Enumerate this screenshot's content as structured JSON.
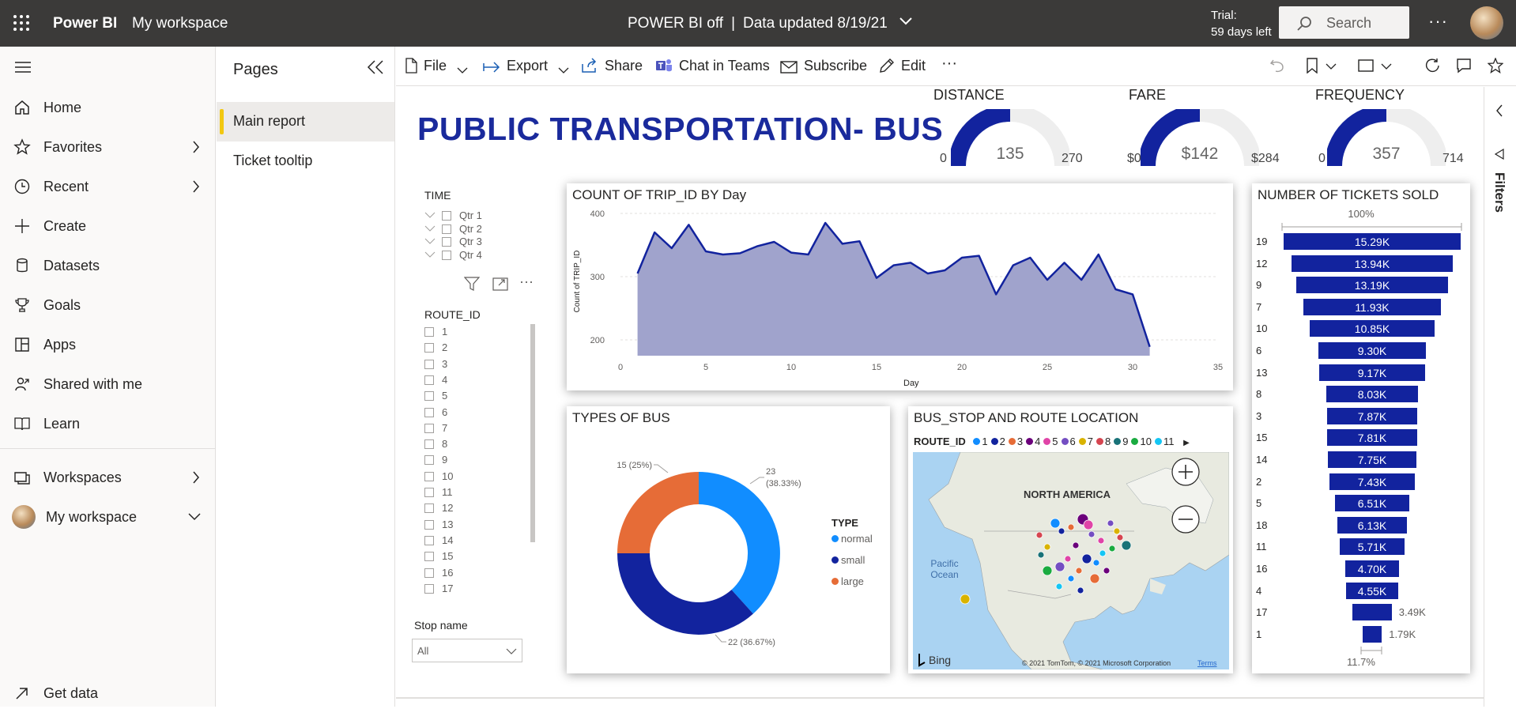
{
  "topbar": {
    "brand": "Power BI",
    "workspace": "My workspace",
    "status_left": "POWER BI off",
    "status_sep": "|",
    "status_right": "Data updated 8/19/21",
    "trial_line1": "Trial:",
    "trial_line2": "59 days left",
    "search_placeholder": "Search",
    "more": "···"
  },
  "nav": {
    "items": [
      {
        "label": "Home"
      },
      {
        "label": "Favorites"
      },
      {
        "label": "Recent"
      },
      {
        "label": "Create"
      },
      {
        "label": "Datasets"
      },
      {
        "label": "Goals"
      },
      {
        "label": "Apps"
      },
      {
        "label": "Shared with me"
      },
      {
        "label": "Learn"
      },
      {
        "label": "Workspaces"
      },
      {
        "label": "My workspace"
      },
      {
        "label": "Get data"
      }
    ]
  },
  "pages": {
    "title": "Pages",
    "items": [
      {
        "label": "Main report"
      },
      {
        "label": "Ticket tooltip"
      }
    ]
  },
  "toolbar": {
    "file": "File",
    "export": "Export",
    "share": "Share",
    "chat": "Chat in Teams",
    "subscribe": "Subscribe",
    "edit": "Edit",
    "more": "···"
  },
  "filters_label": "Filters",
  "report": {
    "title": "PUBLIC TRANSPORTATION- BUS",
    "gauges": [
      {
        "title": "DISTANCE",
        "min": "0",
        "value": "135",
        "max": "270",
        "fraction": 0.5
      },
      {
        "title": "FARE",
        "min": "$0",
        "value": "$142",
        "max": "$284",
        "fraction": 0.5
      },
      {
        "title": "FREQUENCY",
        "min": "0",
        "value": "357",
        "max": "714",
        "fraction": 0.5
      }
    ],
    "time_slicer": {
      "title": "TIME",
      "items": [
        "Qtr 1",
        "Qtr 2",
        "Qtr 3",
        "Qtr 4"
      ]
    },
    "route_slicer": {
      "title": "ROUTE_ID",
      "items": [
        "1",
        "2",
        "3",
        "4",
        "5",
        "6",
        "7",
        "8",
        "9",
        "10",
        "11",
        "12",
        "13",
        "14",
        "15",
        "16",
        "17"
      ]
    },
    "stop_slicer": {
      "title": "Stop name",
      "value": "All"
    },
    "area_chart": {
      "title": "COUNT OF TRIP_ID BY Day",
      "xlabel": "Day",
      "ylabel": "Count of TRIP_ID"
    },
    "donut": {
      "title": "TYPES OF BUS",
      "legend_title": "TYPE",
      "labels": {
        "normal": "23",
        "normal_pct": "(38.33%)",
        "small": "22 (36.67%)",
        "large": "15 (25%)"
      }
    },
    "map": {
      "title": "BUS_STOP AND ROUTE LOCATION",
      "legend_title": "ROUTE_ID",
      "legend_items": [
        {
          "label": "1",
          "color": "#118dff"
        },
        {
          "label": "2",
          "color": "#12239e"
        },
        {
          "label": "3",
          "color": "#e66c37"
        },
        {
          "label": "4",
          "color": "#6b007b"
        },
        {
          "label": "5",
          "color": "#e044a7"
        },
        {
          "label": "6",
          "color": "#744ec2"
        },
        {
          "label": "7",
          "color": "#d9b300"
        },
        {
          "label": "8",
          "color": "#d64550"
        },
        {
          "label": "9",
          "color": "#197278"
        },
        {
          "label": "10",
          "color": "#1aab40"
        },
        {
          "label": "11",
          "color": "#15c6f4"
        }
      ],
      "continent": "NORTH AMERICA",
      "ocean": "Pacific\nOcean",
      "bing": "Bing",
      "copyright": "© 2021 TomTom, © 2021 Microsoft Corporation",
      "terms": "Terms"
    },
    "funnel": {
      "title": "NUMBER OF TICKETS SOLD",
      "top_pct": "100%",
      "bottom_pct": "11.7%"
    }
  },
  "chart_data": [
    {
      "type": "area",
      "title": "COUNT OF TRIP_ID BY Day",
      "xlabel": "Day",
      "ylabel": "Count of TRIP_ID",
      "x": [
        1,
        2,
        3,
        4,
        5,
        6,
        7,
        8,
        9,
        10,
        11,
        12,
        13,
        14,
        15,
        16,
        17,
        18,
        19,
        20,
        21,
        22,
        23,
        24,
        25,
        26,
        27,
        28,
        29,
        30,
        31
      ],
      "y": [
        305,
        370,
        345,
        382,
        340,
        335,
        337,
        348,
        355,
        338,
        335,
        385,
        352,
        356,
        298,
        318,
        322,
        305,
        310,
        330,
        333,
        272,
        318,
        330,
        295,
        322,
        295,
        335,
        280,
        272,
        189
      ],
      "xlim": [
        0,
        35
      ],
      "ylim": [
        175,
        410
      ],
      "xticks": [
        0,
        5,
        10,
        15,
        20,
        25,
        30,
        35
      ],
      "yticks": [
        200,
        300,
        400
      ],
      "color": "#12239e"
    },
    {
      "type": "pie",
      "title": "TYPES OF BUS",
      "categories": [
        "normal",
        "small",
        "large"
      ],
      "values": [
        23,
        22,
        15
      ],
      "colors": [
        "#118dff",
        "#12239e",
        "#e66c37"
      ],
      "legend_placement": "right"
    },
    {
      "type": "bar",
      "title": "NUMBER OF TICKETS SOLD",
      "orientation": "funnel",
      "categories": [
        "19",
        "12",
        "9",
        "7",
        "10",
        "6",
        "13",
        "8",
        "3",
        "15",
        "14",
        "2",
        "5",
        "18",
        "11",
        "16",
        "4",
        "17",
        "1"
      ],
      "values": [
        15290,
        13940,
        13190,
        11930,
        10850,
        9300,
        9170,
        8030,
        7870,
        7810,
        7750,
        7430,
        6510,
        6130,
        5710,
        4700,
        4550,
        3490,
        1790
      ],
      "labels": [
        "15.29K",
        "13.94K",
        "13.19K",
        "11.93K",
        "10.85K",
        "9.30K",
        "9.17K",
        "8.03K",
        "7.87K",
        "7.81K",
        "7.75K",
        "7.43K",
        "6.51K",
        "6.13K",
        "5.71K",
        "4.70K",
        "4.55K",
        "3.49K",
        "1.79K"
      ],
      "color": "#12239e"
    }
  ]
}
